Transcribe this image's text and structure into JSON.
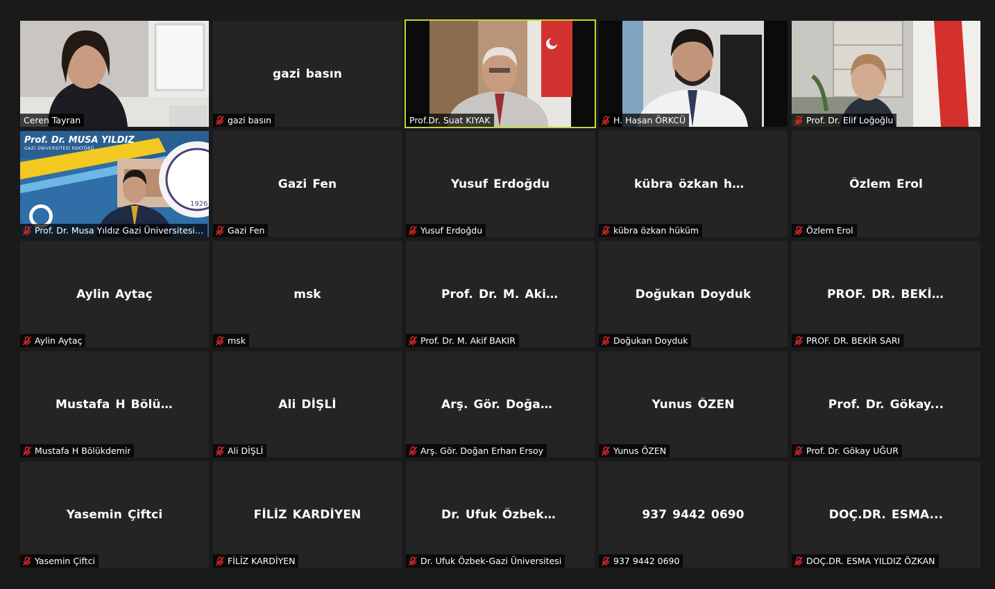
{
  "meeting": {
    "participants": [
      {
        "name": "Ceren Tayran",
        "center": "",
        "video": "woman-office",
        "muted": false,
        "speaking": false
      },
      {
        "name": "gazi basın",
        "center": "gazi basın",
        "video": "",
        "muted": true,
        "speaking": false
      },
      {
        "name": "Prof.Dr. Suat KIYAK",
        "center": "",
        "video": "man-flag",
        "muted": false,
        "speaking": true
      },
      {
        "name": "H. Hasan ÖRKCÜ",
        "center": "",
        "video": "man-office",
        "muted": true,
        "speaking": false
      },
      {
        "name": "Prof. Dr. Elif Loğoğlu",
        "center": "",
        "video": "woman-flag",
        "muted": true,
        "speaking": false
      },
      {
        "name": "Prof. Dr. Musa Yıldız Gazi Üniversitesi Re...",
        "center": "",
        "video": "rector-banner",
        "muted": true,
        "speaking": false
      },
      {
        "name": "Gazi Fen",
        "center": "Gazi Fen",
        "video": "",
        "muted": true,
        "speaking": false
      },
      {
        "name": "Yusuf Erdoğdu",
        "center": "Yusuf Erdoğdu",
        "video": "",
        "muted": true,
        "speaking": false
      },
      {
        "name": "kübra özkan hüküm",
        "center": "kübra özkan hük...",
        "video": "",
        "muted": true,
        "speaking": false
      },
      {
        "name": "Özlem Erol",
        "center": "Özlem Erol",
        "video": "",
        "muted": true,
        "speaking": false
      },
      {
        "name": "Aylin Aytaç",
        "center": "Aylin Aytaç",
        "video": "",
        "muted": true,
        "speaking": false
      },
      {
        "name": "msk",
        "center": "msk",
        "video": "",
        "muted": true,
        "speaking": false
      },
      {
        "name": "Prof. Dr. M. Akif BAKIR",
        "center": "Prof. Dr. M. Akif...",
        "video": "",
        "muted": true,
        "speaking": false
      },
      {
        "name": "Doğukan Doyduk",
        "center": "Doğukan Doyduk",
        "video": "",
        "muted": true,
        "speaking": false
      },
      {
        "name": "PROF. DR. BEKİR SARI",
        "center": "PROF. DR. BEKİR...",
        "video": "",
        "muted": true,
        "speaking": false
      },
      {
        "name": "Mustafa H Bölükdemir",
        "center": "Mustafa H Bölük...",
        "video": "",
        "muted": true,
        "speaking": false
      },
      {
        "name": "Ali DİŞLİ",
        "center": "Ali DİŞLİ",
        "video": "",
        "muted": true,
        "speaking": false
      },
      {
        "name": "Arş. Gör. Doğan Erhan Ersoy",
        "center": "Arş. Gör. Doğan...",
        "video": "",
        "muted": true,
        "speaking": false
      },
      {
        "name": "Yunus ÖZEN",
        "center": "Yunus ÖZEN",
        "video": "",
        "muted": true,
        "speaking": false
      },
      {
        "name": "Prof. Dr. Gökay UĞUR",
        "center": "Prof. Dr. Gökay...",
        "video": "",
        "muted": true,
        "speaking": false
      },
      {
        "name": "Yasemin Çiftci",
        "center": "Yasemin Çiftci",
        "video": "",
        "muted": true,
        "speaking": false
      },
      {
        "name": "FİLİZ KARDİYEN",
        "center": "FİLİZ KARDİYEN",
        "video": "",
        "muted": true,
        "speaking": false
      },
      {
        "name": "Dr. Ufuk Özbek-Gazi Üniversitesi",
        "center": "Dr. Ufuk Özbek-...",
        "video": "",
        "muted": true,
        "speaking": false
      },
      {
        "name": "937 9442 0690",
        "center": "937 9442 0690",
        "video": "",
        "muted": true,
        "speaking": false
      },
      {
        "name": "DOÇ.DR. ESMA YILDIZ ÖZKAN",
        "center": "DOÇ.DR. ESMA...",
        "video": "",
        "muted": true,
        "speaking": false
      }
    ],
    "banner": {
      "title": "Prof. Dr. MUSA YILDIZ",
      "subtitle": "GAZİ ÜNİVERSİTESİ REKTÖRÜ",
      "seal_year": "1926"
    },
    "colors": {
      "speaking_border": "#c3d82c",
      "muted_icon": "#e02828",
      "tile_bg": "#242424",
      "page_bg": "#1a1a1a"
    }
  }
}
